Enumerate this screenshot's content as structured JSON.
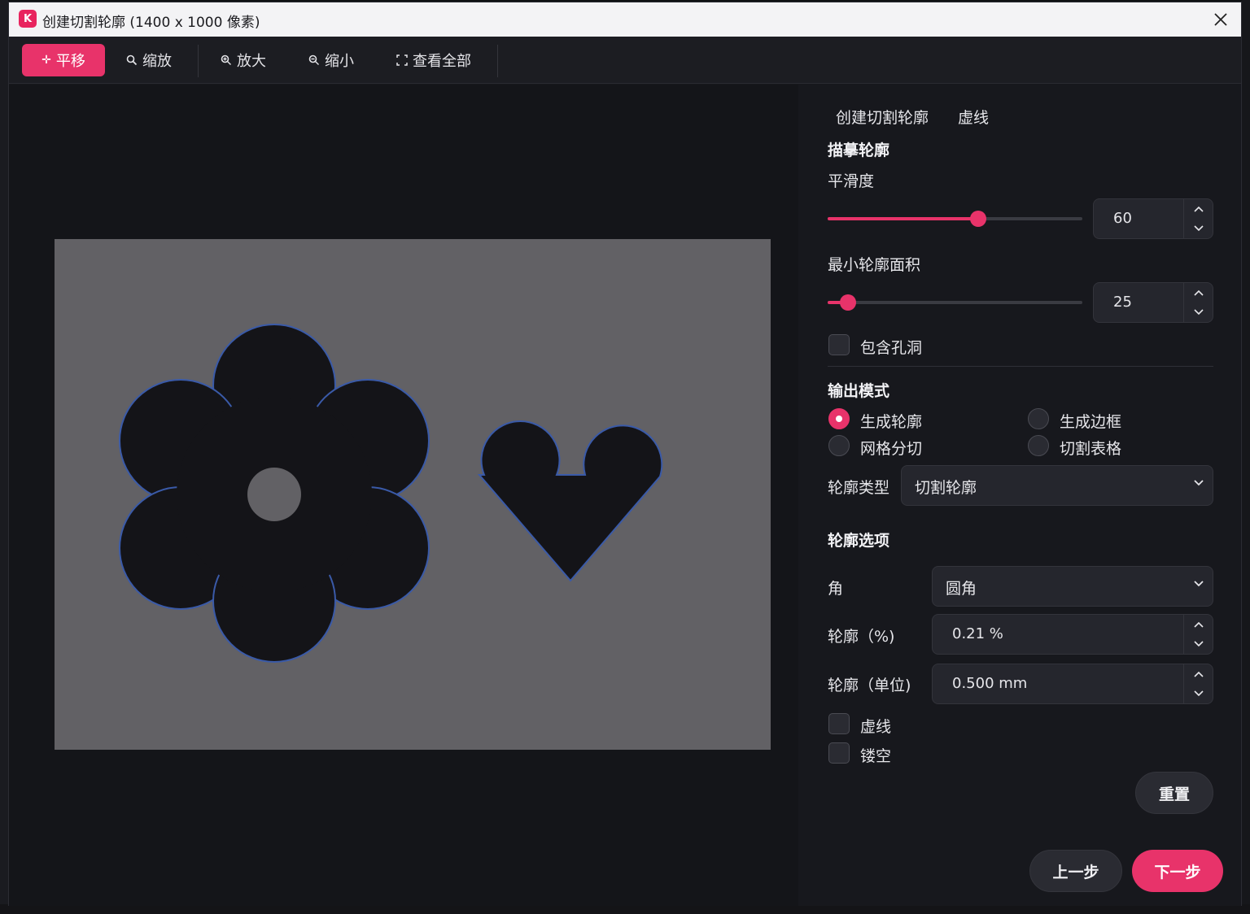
{
  "window": {
    "title": "创建切割轮廓 (1400 x 1000 像素)",
    "app_icon": "K"
  },
  "toolbar": {
    "pan": "平移",
    "zoom": "缩放",
    "zoom_in": "放大",
    "zoom_out": "缩小",
    "fit_all": "查看全部"
  },
  "tabs": {
    "create": "创建切割轮廓",
    "dashed": "虚线"
  },
  "trace": {
    "heading": "描摹轮廓",
    "smoothness_label": "平滑度",
    "smoothness_value": "60",
    "smoothness_fraction": 0.59,
    "min_area_label": "最小轮廓面积",
    "min_area_value": "25",
    "min_area_fraction": 0.08,
    "include_holes": "包含孔洞"
  },
  "output": {
    "heading": "输出模式",
    "opt_contour": "生成轮廓",
    "opt_border": "生成边框",
    "opt_grid": "网格分切",
    "opt_table": "切割表格",
    "selected": "生成轮廓",
    "type_label": "轮廓类型",
    "type_value": "切割轮廓"
  },
  "options": {
    "heading": "轮廓选项",
    "corner_label": "角",
    "corner_value": "圆角",
    "percent_label": "轮廓（%)",
    "percent_value": "0.21 %",
    "unit_label": "轮廓（单位)",
    "unit_value": "0.500 mm",
    "dashed": "虚线",
    "hollow": "镂空"
  },
  "buttons": {
    "reset": "重置",
    "prev": "上一步",
    "next": "下一步"
  },
  "colors": {
    "accent": "#e8336a",
    "canvas_bg": "#626165",
    "shape_fill": "#141418",
    "contour": "#3a5aa8"
  },
  "icons": {
    "pan": "move-icon",
    "zoom": "magnifier-icon",
    "zoom_in": "zoom-in-icon",
    "zoom_out": "zoom-out-icon",
    "fit_all": "fit-screen-icon",
    "close": "close-icon"
  }
}
